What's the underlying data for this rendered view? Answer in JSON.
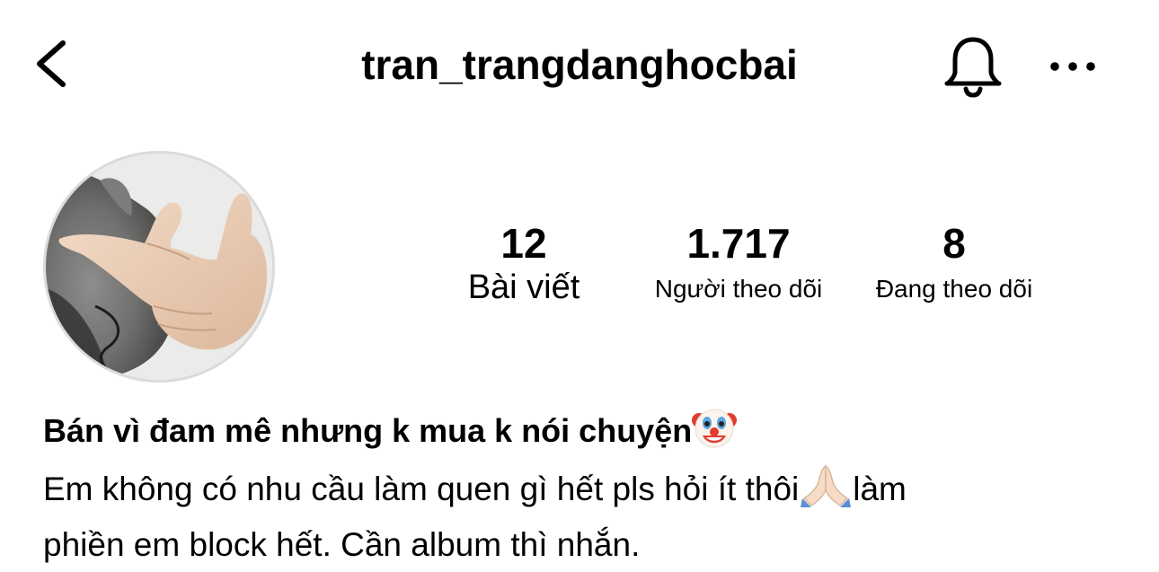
{
  "header": {
    "username": "tran_trangdanghocbai",
    "back_icon": "chevron-left-icon",
    "notification_icon": "bell-icon",
    "more_icon": "more-horizontal-icon"
  },
  "profile": {
    "avatar_icon": "profile-photo"
  },
  "stats": {
    "posts": {
      "count": "12",
      "label": "Bài viết"
    },
    "followers": {
      "count": "1.717",
      "label": "Người theo dõi"
    },
    "following": {
      "count": "8",
      "label": "Đang theo dõi"
    }
  },
  "bio": {
    "name": "Bán vì đam mê nhưng k mua k nói chuyện",
    "name_emoji": "clown-face-emoji",
    "line1_a": "Em không có nhu cầu làm quen gì hết pls hỏi ít thôi",
    "line1_emoji": "folded-hands-emoji",
    "line1_b": "làm",
    "line2": "phiền em block hết. Cần album thì nhắn."
  },
  "colors": {
    "text": "#000000",
    "avatar_border": "#dbdbdb",
    "background": "#ffffff"
  }
}
